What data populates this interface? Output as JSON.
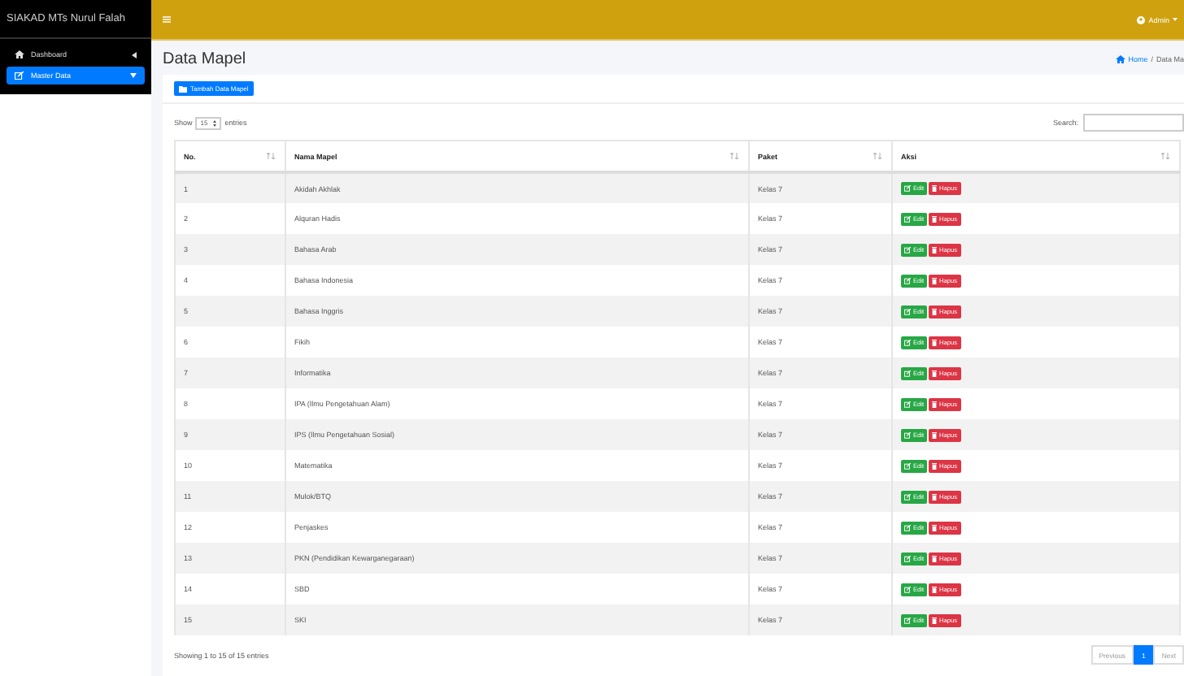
{
  "sidebar": {
    "brand": "SIAKAD MTs Nurul Falah",
    "items": [
      {
        "label": "Dashboard",
        "selected": false
      },
      {
        "label": "Master Data",
        "selected": true
      }
    ]
  },
  "topbar": {
    "user": "Admin"
  },
  "page": {
    "title": "Data Mapel",
    "breadcrumb": [
      "Home",
      "/",
      "Data Ma"
    ]
  },
  "add_button": "Tambah Data Mapel",
  "length": {
    "before": "Show",
    "value": "15",
    "after": "entries"
  },
  "search": {
    "label": "Search:"
  },
  "table": {
    "columns": [
      "No.",
      "Nama Mapel",
      "Paket",
      "Aksi"
    ],
    "rows": [
      {
        "cells": [
          "1",
          "Akidah Akhlak",
          "Kelas 7"
        ],
        "actions": [
          "Edit",
          "Hapus"
        ]
      },
      {
        "cells": [
          "2",
          "Alquran Hadis",
          "Kelas 7"
        ],
        "actions": [
          "Edit",
          "Hapus"
        ]
      },
      {
        "cells": [
          "3",
          "Bahasa Arab",
          "Kelas 7"
        ],
        "actions": [
          "Edit",
          "Hapus"
        ]
      },
      {
        "cells": [
          "4",
          "Bahasa Indonesia",
          "Kelas 7"
        ],
        "actions": [
          "Edit",
          "Hapus"
        ]
      },
      {
        "cells": [
          "5",
          "Bahasa Inggris",
          "Kelas 7"
        ],
        "actions": [
          "Edit",
          "Hapus"
        ]
      },
      {
        "cells": [
          "6",
          "Fikih",
          "Kelas 7"
        ],
        "actions": [
          "Edit",
          "Hapus"
        ]
      },
      {
        "cells": [
          "7",
          "Informatika",
          "Kelas 7"
        ],
        "actions": [
          "Edit",
          "Hapus"
        ]
      },
      {
        "cells": [
          "8",
          "IPA (Ilmu Pengetahuan Alam)",
          "Kelas 7"
        ],
        "actions": [
          "Edit",
          "Hapus"
        ]
      },
      {
        "cells": [
          "9",
          "IPS (Ilmu Pengetahuan Sosial)",
          "Kelas 7"
        ],
        "actions": [
          "Edit",
          "Hapus"
        ]
      },
      {
        "cells": [
          "10",
          "Matematika",
          "Kelas 7"
        ],
        "actions": [
          "Edit",
          "Hapus"
        ]
      },
      {
        "cells": [
          "11",
          "Mulok/BTQ",
          "Kelas 7"
        ],
        "actions": [
          "Edit",
          "Hapus"
        ]
      },
      {
        "cells": [
          "12",
          "Penjaskes",
          "Kelas 7"
        ],
        "actions": [
          "Edit",
          "Hapus"
        ]
      },
      {
        "cells": [
          "13",
          "PKN (Pendidikan Kewarganegaraan)",
          "Kelas 7"
        ],
        "actions": [
          "Edit",
          "Hapus"
        ]
      },
      {
        "cells": [
          "14",
          "SBD",
          "Kelas 7"
        ],
        "actions": [
          "Edit",
          "Hapus"
        ]
      },
      {
        "cells": [
          "15",
          "SKI",
          "Kelas 7"
        ],
        "actions": [
          "Edit",
          "Hapus"
        ]
      }
    ]
  },
  "info": "Showing 1 to 15 of 15 entries",
  "pagination": [
    {
      "label": "Previous",
      "selected": false
    },
    {
      "label": "1",
      "selected": true
    },
    {
      "label": "Next",
      "selected": false
    }
  ]
}
